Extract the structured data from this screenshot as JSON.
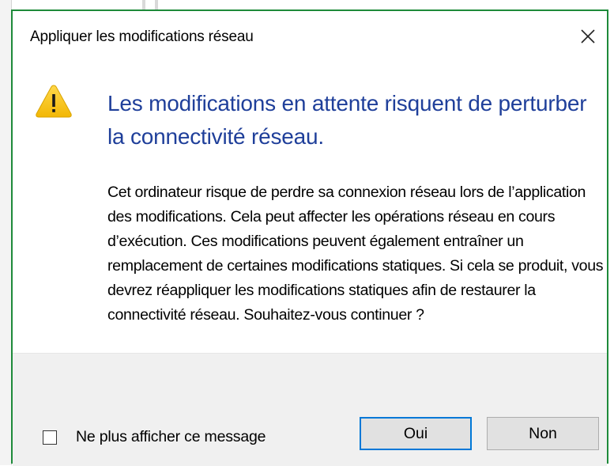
{
  "dialog": {
    "title": "Appliquer les modifications réseau",
    "close_icon": "close-icon",
    "warning_icon": "warning-icon",
    "main_instruction": "Les modifications en attente risquent de perturber la connectivité réseau.",
    "content": "Cet ordinateur risque de perdre sa connexion réseau lors de l’application des modifications. Cela peut affecter les opérations réseau en cours d’exécution. Ces modifications peuvent également entraîner un remplacement de certaines modifications statiques. Si cela se produit, vous devrez réappliquer les modifications statiques afin de restaurer la connectivité réseau. Souhaitez-vous continuer ?",
    "checkbox_label": "Ne plus afficher ce message",
    "checkbox_checked": false,
    "yes_button": "Oui",
    "no_button": "Non"
  },
  "colors": {
    "border": "#1e8a3a",
    "instruction": "#1f3f9a",
    "default_button_border": "#0078d7",
    "footer_bg": "#f0f0f0",
    "warning_yellow": "#f6c619"
  }
}
